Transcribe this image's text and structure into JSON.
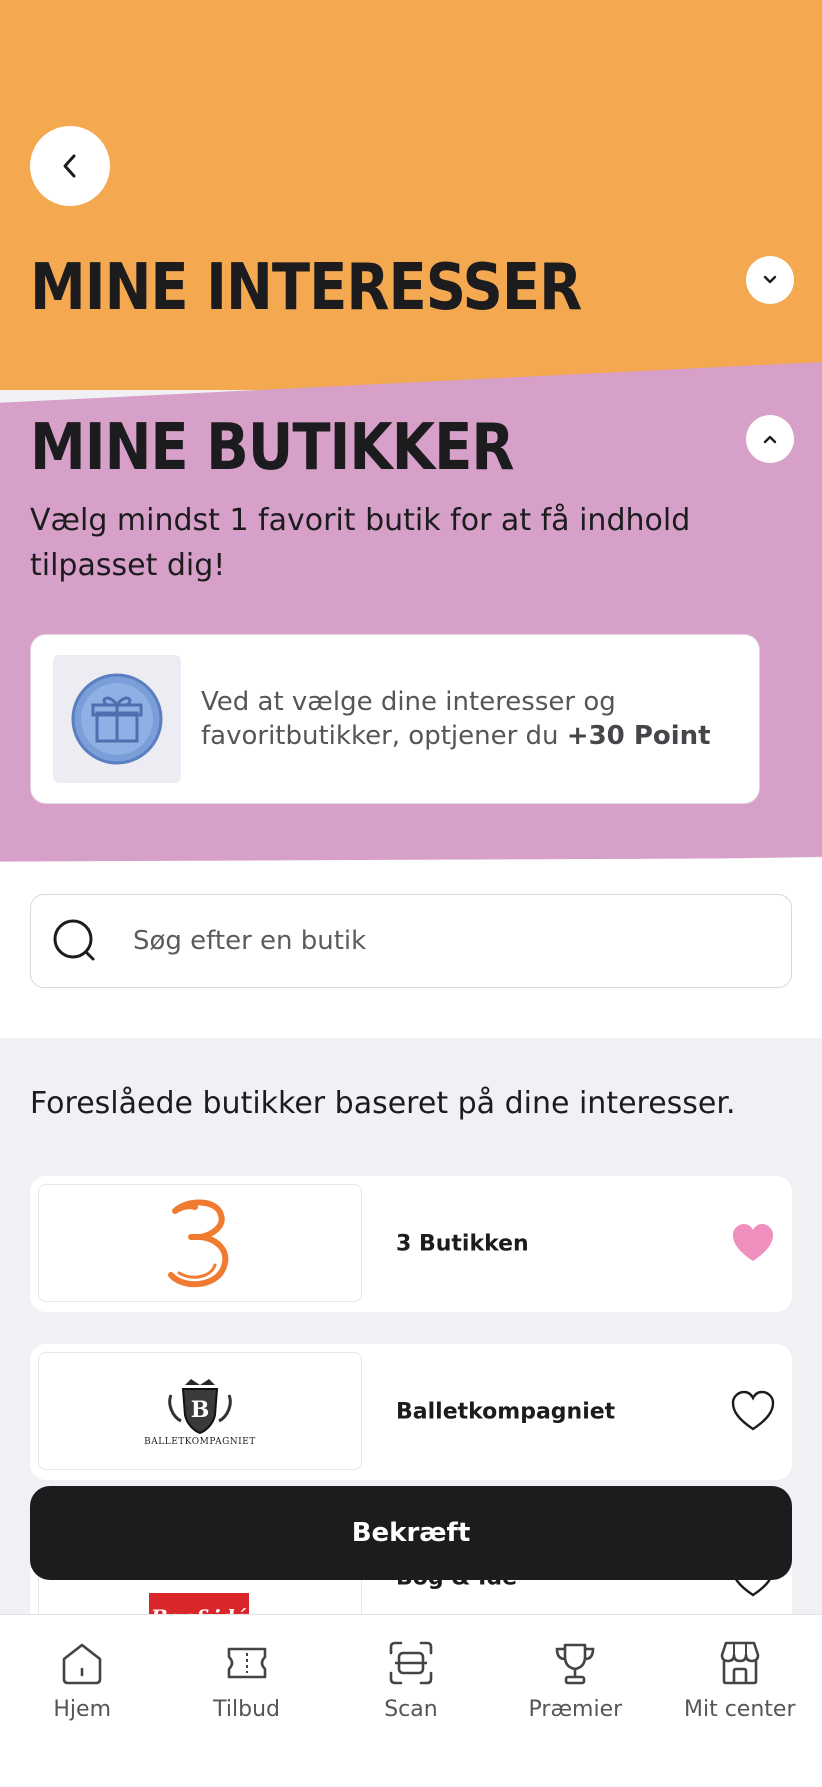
{
  "header": {
    "interests_title": "MINE INTERESSER",
    "stores_title": "MINE BUTIKKER",
    "stores_subtitle": "Vælg mindst 1 favorit butik for at få indhold tilpasset dig!"
  },
  "points_card": {
    "text": "Ved at vælge dine interesser og favoritbutikker, optjener du",
    "points": "+30 Point"
  },
  "search": {
    "placeholder": "Søg efter en butik"
  },
  "suggestions": {
    "heading": "Foreslåede butikker baseret på dine interesser.",
    "stores": [
      {
        "name": "3 Butikken",
        "favorite": true
      },
      {
        "name": "Balletkompagniet",
        "logo_text": "BALLETKOMPAGNIET",
        "favorite": false
      },
      {
        "name": "Bog & Idé",
        "logo_text": "Bog&idé",
        "favorite": false
      }
    ]
  },
  "confirm_label": "Bekræft",
  "tabs": [
    {
      "label": "Hjem",
      "icon": "home-icon"
    },
    {
      "label": "Tilbud",
      "icon": "ticket-icon"
    },
    {
      "label": "Scan",
      "icon": "scan-icon"
    },
    {
      "label": "Præmier",
      "icon": "trophy-icon"
    },
    {
      "label": "Mit center",
      "icon": "store-icon"
    }
  ],
  "colors": {
    "interests_bg": "#f4a850",
    "stores_bg": "#d7a0c8",
    "heart_active": "#ef8fbd",
    "button_bg": "#1c1c1e"
  }
}
